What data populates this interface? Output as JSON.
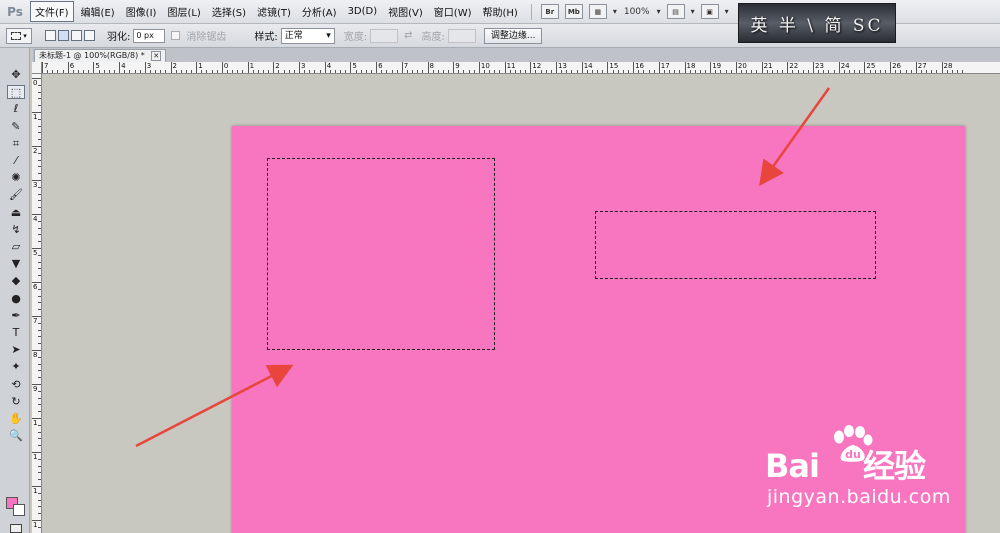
{
  "app": {
    "logo": "Ps"
  },
  "menu": [
    {
      "label": "文件(F)",
      "active": true
    },
    {
      "label": "编辑(E)"
    },
    {
      "label": "图像(I)"
    },
    {
      "label": "图层(L)"
    },
    {
      "label": "选择(S)"
    },
    {
      "label": "滤镜(T)"
    },
    {
      "label": "分析(A)"
    },
    {
      "label": "3D(D)"
    },
    {
      "label": "视图(V)"
    },
    {
      "label": "窗口(W)"
    },
    {
      "label": "帮助(H)"
    }
  ],
  "menubar_tools": {
    "bridge": "Br",
    "mini_bridge": "Mb",
    "zoom": "100%"
  },
  "banner": {
    "text": "英 半 \\ 简 SC"
  },
  "options": {
    "feather_label": "羽化:",
    "feather_value": "0 px",
    "antialias_label": "消除锯齿",
    "style_label": "样式:",
    "style_value": "正常",
    "width_label": "宽度:",
    "height_label": "高度:",
    "refine_edge_button": "调整边缘..."
  },
  "document": {
    "tab_title": "未标题-1 @ 100%(RGB/8) *",
    "canvas_color": "#f875c0"
  },
  "ruler": {
    "h_labels": [
      "7",
      "6",
      "5",
      "4",
      "3",
      "2",
      "1",
      "0",
      "1",
      "2",
      "3",
      "4",
      "5",
      "6",
      "7",
      "8",
      "9",
      "10",
      "11",
      "12",
      "13",
      "14",
      "15",
      "16",
      "17",
      "18",
      "19",
      "20",
      "21",
      "22",
      "23",
      "24",
      "25",
      "26",
      "27",
      "28"
    ],
    "v_labels": [
      "0",
      "1",
      "2",
      "3",
      "4",
      "5",
      "6",
      "7",
      "8",
      "9",
      "1",
      "1",
      "1",
      "1"
    ]
  },
  "toolbox": [
    {
      "name": "move-tool-icon",
      "glyph": "✥"
    },
    {
      "name": "rect-marquee-tool-icon",
      "glyph": "⬚",
      "selected": true
    },
    {
      "name": "lasso-tool-icon",
      "glyph": "ℓ"
    },
    {
      "name": "quick-select-tool-icon",
      "glyph": "✎"
    },
    {
      "name": "crop-tool-icon",
      "glyph": "⌗"
    },
    {
      "name": "eyedropper-tool-icon",
      "glyph": "⁄"
    },
    {
      "name": "spot-heal-tool-icon",
      "glyph": "✺"
    },
    {
      "name": "brush-tool-icon",
      "glyph": "🖌"
    },
    {
      "name": "clone-stamp-tool-icon",
      "glyph": "⏏"
    },
    {
      "name": "history-brush-tool-icon",
      "glyph": "↯"
    },
    {
      "name": "eraser-tool-icon",
      "glyph": "▱"
    },
    {
      "name": "paint-bucket-tool-icon",
      "glyph": "▼"
    },
    {
      "name": "blur-tool-icon",
      "glyph": "◆"
    },
    {
      "name": "dodge-tool-icon",
      "glyph": "●"
    },
    {
      "name": "pen-tool-icon",
      "glyph": "✒"
    },
    {
      "name": "type-tool-icon",
      "glyph": "T"
    },
    {
      "name": "path-select-tool-icon",
      "glyph": "➤"
    },
    {
      "name": "shape-tool-icon",
      "glyph": "✦"
    },
    {
      "name": "3d-rotate-tool-icon",
      "glyph": "⟲"
    },
    {
      "name": "3d-orbit-tool-icon",
      "glyph": "↻"
    },
    {
      "name": "hand-tool-icon",
      "glyph": "✋"
    },
    {
      "name": "zoom-tool-icon",
      "glyph": "🔍"
    }
  ],
  "colors": {
    "foreground": "#f875c0",
    "background": "#ffffff"
  },
  "watermark": {
    "brand": "Bai",
    "brand_tail": "du",
    "brand_cn": "经验",
    "url": "jingyan.baidu.com"
  }
}
